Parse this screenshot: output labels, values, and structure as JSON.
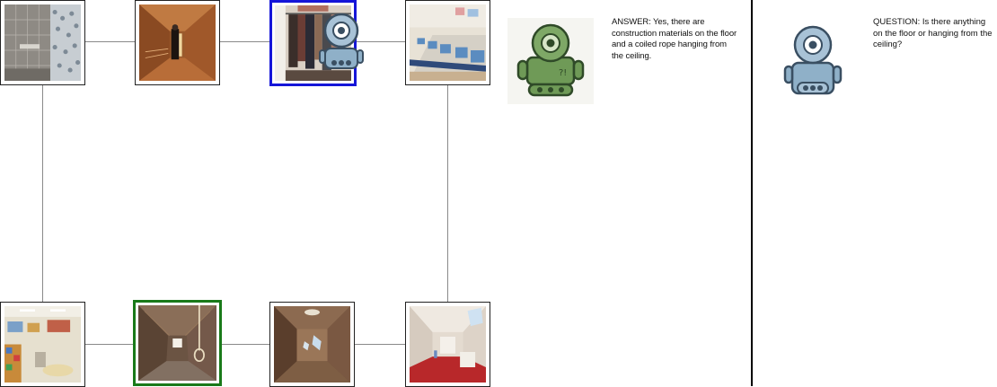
{
  "answer": {
    "text": "ANSWER: Yes, there are construction materials on the floor and a coiled rope hanging from the ceiling."
  },
  "question": {
    "text": "QUESTION: Is there anything on the floor or hanging from the ceiling?"
  },
  "colors": {
    "current_node_border": "#1515d8",
    "target_node_border": "#1a7a1a",
    "edge": "#8a8a8a",
    "answer_robot": "#6f9a57",
    "question_robot": "#8fb0c8"
  },
  "icons": {
    "answerer": "green-robot-icon",
    "questioner": "blue-robot-icon"
  },
  "scenes": [
    "bathroom-shower",
    "attic-wood-person",
    "closet-clothes",
    "computer-lab",
    "classroom",
    "attic-rope",
    "attic-empty-skylight",
    "attic-red-carpet"
  ]
}
